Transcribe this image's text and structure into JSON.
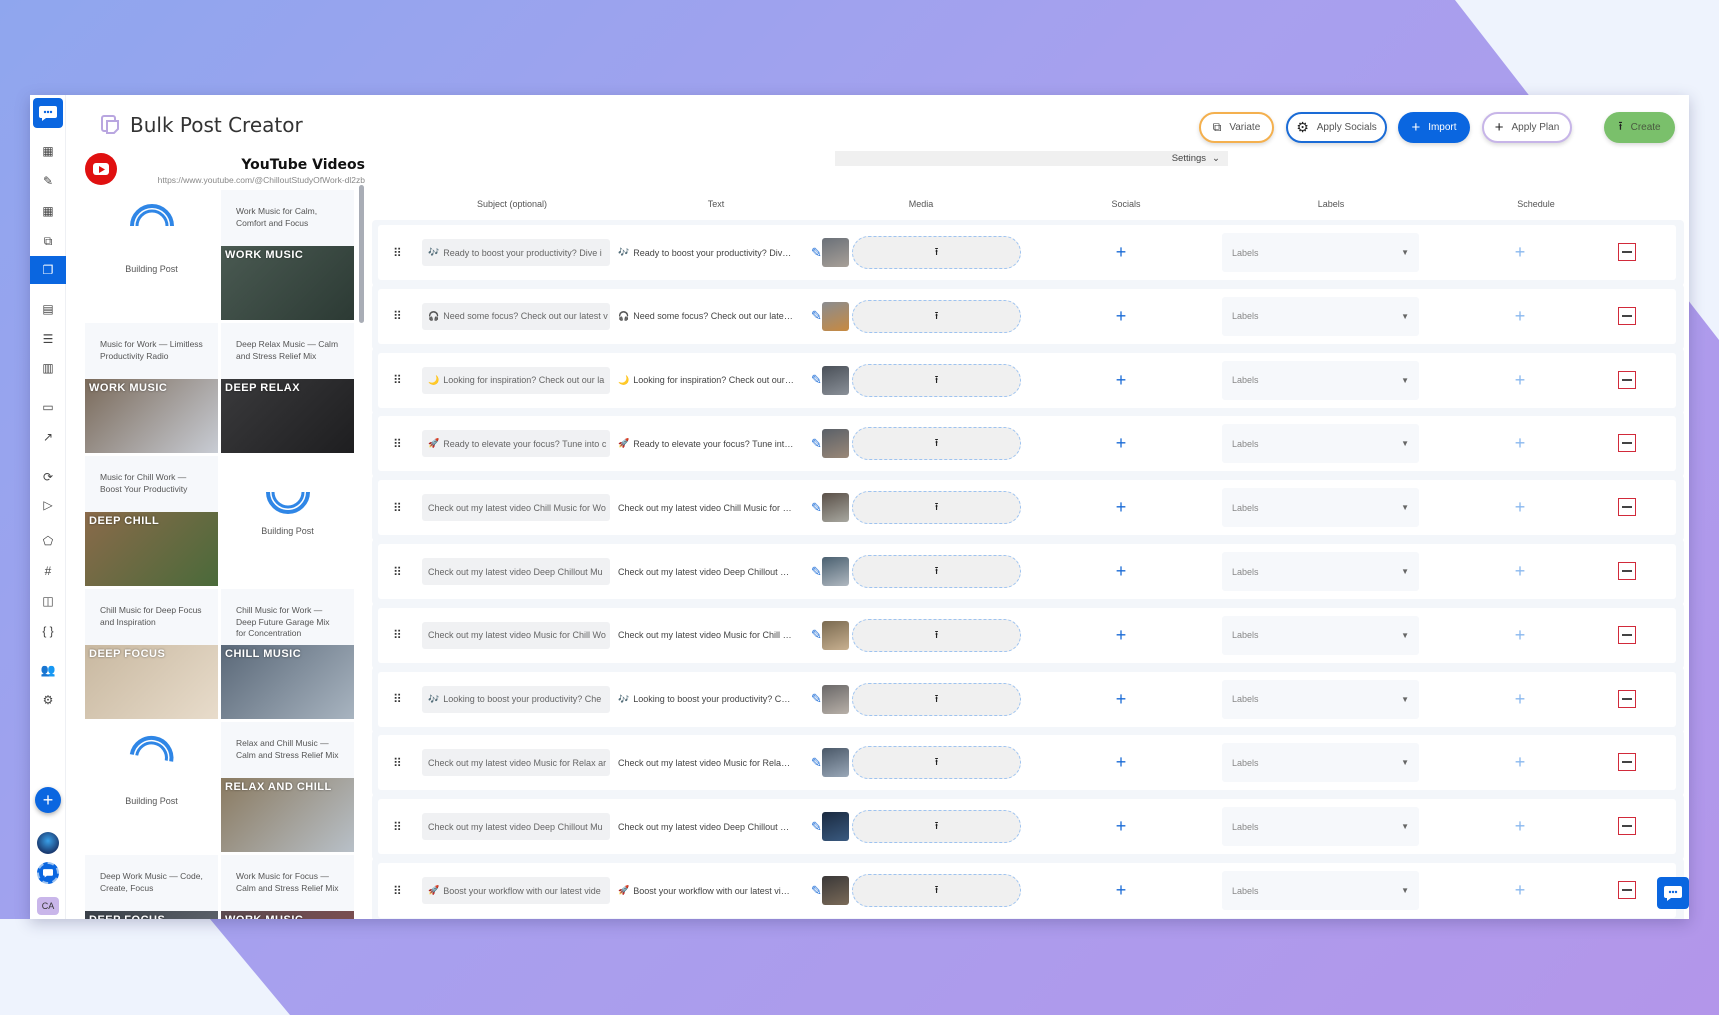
{
  "app": {
    "title": "Bulk Post Creator"
  },
  "sidebar": {
    "items": [
      {
        "name": "dashboard",
        "glyph": "▦"
      },
      {
        "name": "compose",
        "glyph": "✎"
      },
      {
        "name": "apps",
        "glyph": "▦"
      },
      {
        "name": "media-library",
        "glyph": "⧉"
      },
      {
        "name": "bulk-post-creator",
        "glyph": "❐",
        "active": true
      },
      {
        "name": "calendar",
        "glyph": "▤"
      },
      {
        "name": "list",
        "glyph": "☰"
      },
      {
        "name": "columns",
        "glyph": "▥"
      },
      {
        "name": "inbox",
        "glyph": "▭"
      },
      {
        "name": "analytics",
        "glyph": "↗"
      },
      {
        "name": "recycle",
        "glyph": "⟳"
      },
      {
        "name": "play",
        "glyph": "▷"
      },
      {
        "name": "labels",
        "glyph": "⬠"
      },
      {
        "name": "hashtags",
        "glyph": "#"
      },
      {
        "name": "layout",
        "glyph": "◫"
      },
      {
        "name": "code",
        "glyph": "{ }"
      },
      {
        "name": "team",
        "glyph": "👥"
      },
      {
        "name": "settings",
        "glyph": "⚙"
      }
    ],
    "add_label": "+",
    "user_initials": "CA"
  },
  "toolbar": {
    "variate": "Variate",
    "apply_socials": "Apply Socials",
    "import": "Import",
    "apply_plan": "Apply Plan",
    "create": "Create",
    "settings": "Settings"
  },
  "youtube": {
    "title": "YouTube Videos",
    "url": "https://www.youtube.com/@ChilloutStudyOfWork-dl2zb",
    "tiles": [
      {
        "type": "building",
        "label": "Building Post"
      },
      {
        "type": "video",
        "title": "Work Music for Calm, Comfort and Focus",
        "brand": "WORK MUSIC",
        "colors": [
          "#4a5a52",
          "#2c3a34"
        ]
      },
      {
        "type": "video",
        "title": "Music for Work — Limitless Productivity Radio",
        "brand": "WORK MUSIC",
        "colors": [
          "#7a6a5a",
          "#c8ccd4"
        ]
      },
      {
        "type": "video",
        "title": "Deep Relax Music — Calm and Stress Relief Mix",
        "brand": "DEEP RELAX",
        "colors": [
          "#3a3a3c",
          "#1e1e20"
        ]
      },
      {
        "type": "video",
        "title": "Music for Chill Work — Boost Your Productivity",
        "brand": "DEEP CHILL",
        "colors": [
          "#8a6a4a",
          "#4a6a3a"
        ]
      },
      {
        "type": "building",
        "label": "Building Post"
      },
      {
        "type": "video",
        "title": "Chill Music for Deep Focus and Inspiration",
        "brand": "DEEP FOCUS",
        "colors": [
          "#c8b8a0",
          "#e8dccb"
        ]
      },
      {
        "type": "video",
        "title": "Chill Music for Work — Deep Future Garage Mix for Concentration",
        "brand": "CHILL MUSIC",
        "colors": [
          "#5a6878",
          "#a8b4c0"
        ]
      },
      {
        "type": "building",
        "label": "Building Post"
      },
      {
        "type": "video",
        "title": "Relax and Chill Music — Calm and Stress Relief Mix",
        "brand": "RELAX AND CHILL",
        "colors": [
          "#8a7a60",
          "#b8c0c8"
        ]
      },
      {
        "type": "video",
        "title": "Deep Work Music — Code, Create, Focus",
        "brand": "DEEP FOCUS",
        "colors": [
          "#3a4048",
          "#6a7078"
        ]
      },
      {
        "type": "video",
        "title": "Work Music for Focus — Calm and Stress Relief Mix",
        "brand": "WORK MUSIC",
        "colors": [
          "#5a4a50",
          "#8a5050"
        ]
      }
    ]
  },
  "table": {
    "headers": {
      "subject": "Subject (optional)",
      "text": "Text",
      "media": "Media",
      "socials": "Socials",
      "labels": "Labels",
      "schedule": "Schedule"
    },
    "labels_placeholder": "Labels",
    "rows": [
      {
        "emoji": "🎶",
        "subject": "Ready to boost your productivity? Dive i",
        "text": "Ready to boost your productivity? Dive i...",
        "thumb": [
          "#6a7078",
          "#a8a098"
        ]
      },
      {
        "emoji": "🎧",
        "subject": "Need some focus? Check out our latest v",
        "text": "Need some focus? Check out our latest ...",
        "thumb": [
          "#8a8c90",
          "#c88a40"
        ]
      },
      {
        "emoji": "🌙",
        "subject": "Looking for inspiration? Check out our la",
        "text": "Looking for inspiration? Check out our la...",
        "thumb": [
          "#4a5058",
          "#8a9098"
        ]
      },
      {
        "emoji": "🚀",
        "subject": "Ready to elevate your focus? Tune into c",
        "text": "Ready to elevate your focus? Tune into o...",
        "thumb": [
          "#5a6068",
          "#9a8878"
        ]
      },
      {
        "emoji": "",
        "subject": "Check out my latest video Chill Music for Wo",
        "text": "Check out my latest video Chill Music for W...",
        "thumb": [
          "#5a5048",
          "#a8a8a0"
        ]
      },
      {
        "emoji": "",
        "subject": "Check out my latest video Deep Chillout Mu",
        "text": "Check out my latest video Deep Chillout Mu...",
        "thumb": [
          "#4a6070",
          "#b0b8c0"
        ]
      },
      {
        "emoji": "",
        "subject": "Check out my latest video Music for Chill Wo",
        "text": "Check out my latest video Music for Chill W...",
        "thumb": [
          "#7a6a50",
          "#c8b090"
        ]
      },
      {
        "emoji": "🎶",
        "subject": "Looking to boost your productivity? Che",
        "text": "Looking to boost your productivity? Che...",
        "thumb": [
          "#6a6868",
          "#b8b0a8"
        ]
      },
      {
        "emoji": "",
        "subject": "Check out my latest video Music for Relax ar",
        "text": "Check out my latest video Music for Relax a...",
        "thumb": [
          "#4a5868",
          "#9aa8b8"
        ]
      },
      {
        "emoji": "",
        "subject": "Check out my latest video Deep Chillout Mu",
        "text": "Check out my latest video Deep Chillout Mu...",
        "thumb": [
          "#1a2a40",
          "#3a5a80"
        ]
      },
      {
        "emoji": "🚀",
        "subject": "Boost your workflow with our latest vide",
        "text": "Boost your workflow with our latest vide...",
        "thumb": [
          "#3a3838",
          "#7a6a58"
        ]
      }
    ]
  },
  "colors": {
    "primary": "#0a66e0",
    "create": "#7ac06b",
    "variate_border": "#f4b04e",
    "plan_border": "#c7b5e8",
    "remove": "#d12a3a",
    "row_accent": "#f4a233"
  }
}
